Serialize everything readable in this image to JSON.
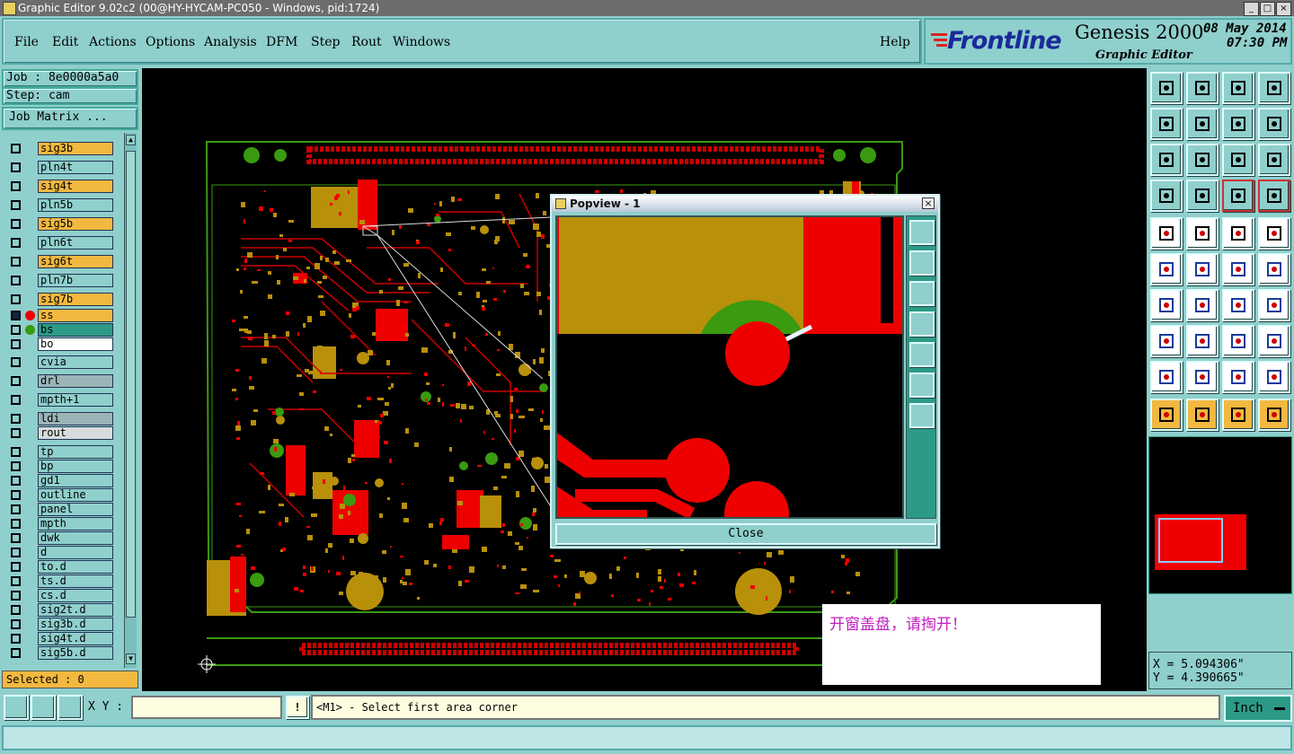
{
  "titlebar": {
    "title": "Graphic Editor 9.02c2 (00@HY-HYCAM-PC050 - Windows, pid:1724)"
  },
  "menu": {
    "items": [
      "File",
      "Edit",
      "Actions",
      "Options",
      "Analysis",
      "DFM",
      "Step",
      "Rout",
      "Windows"
    ],
    "help": "Help"
  },
  "brand": {
    "logo": "Frontline",
    "product": "Genesis 2000",
    "subtitle": "Graphic Editor",
    "date": "08 May 2014",
    "time": "07:30 PM"
  },
  "job": {
    "job": "Job : 8e0000a5a0",
    "step": "Step: cam",
    "matrix_button": "Job Matrix ..."
  },
  "layers": [
    {
      "name": "sig3b",
      "style": "yel"
    },
    {
      "name": "pln4t",
      "style": ""
    },
    {
      "name": "sig4t",
      "style": "yel"
    },
    {
      "name": "pln5b",
      "style": ""
    },
    {
      "name": "sig5b",
      "style": "yel"
    },
    {
      "name": "pln6t",
      "style": ""
    },
    {
      "name": "sig6t",
      "style": "yel"
    },
    {
      "name": "pln7b",
      "style": ""
    },
    {
      "name": "sig7b",
      "style": "yel"
    },
    {
      "name": "ss",
      "style": "yel"
    },
    {
      "name": "bs",
      "style": "grn"
    },
    {
      "name": "bo",
      "style": "wht"
    },
    {
      "name": "cvia",
      "style": ""
    },
    {
      "name": "drl",
      "style": "gry"
    },
    {
      "name": "mpth+1",
      "style": ""
    },
    {
      "name": "ldi",
      "style": "gry"
    },
    {
      "name": "rout",
      "style": "lgr"
    },
    {
      "name": "tp",
      "style": ""
    },
    {
      "name": "bp",
      "style": ""
    },
    {
      "name": "gd1",
      "style": ""
    },
    {
      "name": "outline",
      "style": ""
    },
    {
      "name": "panel",
      "style": ""
    },
    {
      "name": "mpth",
      "style": ""
    },
    {
      "name": "dwk",
      "style": ""
    },
    {
      "name": "d",
      "style": ""
    },
    {
      "name": "to.d",
      "style": ""
    },
    {
      "name": "ts.d",
      "style": ""
    },
    {
      "name": "cs.d",
      "style": ""
    },
    {
      "name": "sig2t.d",
      "style": ""
    },
    {
      "name": "sig3b.d",
      "style": ""
    },
    {
      "name": "sig4t.d",
      "style": ""
    },
    {
      "name": "sig5b.d",
      "style": ""
    }
  ],
  "selected": "Selected : 0",
  "popview": {
    "title": "Popview - 1",
    "close_label": "Close"
  },
  "note": {
    "text": "开窗盖盘，请掏开！"
  },
  "coords": {
    "x": "X = 5.094306\"",
    "y": "Y = 4.390665\""
  },
  "statusbar": {
    "xy_label": "X Y :",
    "xy_value": "",
    "prompt": "<M1> - Select first area corner",
    "unit": "Inch"
  },
  "colors": {
    "background": "#8fcfcc",
    "signal_layer": "#f2b840",
    "copper": "#ff0000",
    "mask": "#b8900a",
    "accent_green": "#3a9a10"
  }
}
